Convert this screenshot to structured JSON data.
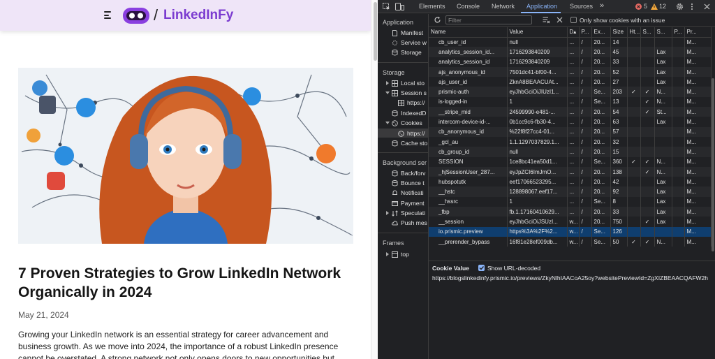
{
  "site": {
    "logo_slash": "/",
    "logo_text": "LinkedInFy"
  },
  "article": {
    "title": "7 Proven Strategies to Grow LinkedIn Network Organically in 2024",
    "date": "May 21, 2024",
    "body": "Growing your LinkedIn network is an essential strategy for career advancement and business growth. As we move into 2024, the importance of a robust LinkedIn presence cannot be overstated. A strong network not only opens doors to new opportunities but also"
  },
  "devtools": {
    "tabs": [
      "Elements",
      "Console",
      "Network",
      "Application",
      "Sources"
    ],
    "active_tab": "Application",
    "more": "»",
    "error_count": "5",
    "warning_count": "12",
    "filter_placeholder": "Filter",
    "only_issue_label": "Only show cookies with an issue",
    "sidebar": {
      "application_head": "Application",
      "application_items": [
        "Manifest",
        "Service w",
        "Storage"
      ],
      "storage_head": "Storage",
      "storage_items": [
        "Local sto",
        "Session s",
        "https://",
        "IndexedD",
        "Cookies",
        "https://",
        "Cache sto"
      ],
      "background_head": "Background ser",
      "background_items": [
        "Back/forv",
        "Bounce t",
        "Notificati",
        "Payment",
        "Speculati",
        "Push mes"
      ],
      "frames_head": "Frames",
      "frames_items": [
        "top"
      ]
    },
    "columns": [
      "Name",
      "Value",
      "D▴",
      "P...",
      "Ex...",
      "Size",
      "Ht...",
      "S...",
      "S...",
      "P...",
      "Pr..."
    ],
    "rows": [
      [
        "cb_user_id",
        "null",
        "...",
        "/",
        "20...",
        "14",
        "",
        "",
        "",
        "",
        "M..."
      ],
      [
        "analytics_session_id...",
        "1716293840209",
        "...",
        "/",
        "20...",
        "45",
        "",
        "",
        "Lax",
        "",
        "M..."
      ],
      [
        "analytics_session_id",
        "1716293840209",
        "...",
        "/",
        "20...",
        "33",
        "",
        "",
        "Lax",
        "",
        "M..."
      ],
      [
        "ajs_anonymous_id",
        "7501dc41-bf00-4...",
        "...",
        "/",
        "20...",
        "52",
        "",
        "",
        "Lax",
        "",
        "M..."
      ],
      [
        "ajs_user_id",
        "ZknA8BEAACUAt...",
        "...",
        "/",
        "20...",
        "27",
        "",
        "",
        "Lax",
        "",
        "M..."
      ],
      [
        "prismic-auth",
        "eyJhbGciOiJIUzI1...",
        "...",
        "/",
        "Se...",
        "203",
        "✓",
        "✓",
        "N...",
        "",
        "M..."
      ],
      [
        "is-logged-in",
        "1",
        "...",
        "/",
        "Se...",
        "13",
        "",
        "✓",
        "N...",
        "",
        "M..."
      ],
      [
        "__stripe_mid",
        "24599990-e481-...",
        "...",
        "/",
        "20...",
        "54",
        "",
        "✓",
        "St...",
        "",
        "M..."
      ],
      [
        "intercom-device-id-...",
        "0b1cc9c6-fb30-4...",
        "...",
        "/",
        "20...",
        "63",
        "",
        "",
        "Lax",
        "",
        "M..."
      ],
      [
        "cb_anonymous_id",
        "%22f8f27cc4-01...",
        "...",
        "/",
        "20...",
        "57",
        "",
        "",
        "",
        "",
        "M..."
      ],
      [
        "_gcl_au",
        "1.1.1297037829.1...",
        "...",
        "/",
        "20...",
        "32",
        "",
        "",
        "",
        "",
        "M..."
      ],
      [
        "cb_group_id",
        "null",
        "...",
        "/",
        "20...",
        "15",
        "",
        "",
        "",
        "",
        "M..."
      ],
      [
        "SESSION",
        "1ce8bc41ea50d1...",
        "...",
        "/",
        "Se...",
        "360",
        "✓",
        "✓",
        "N...",
        "",
        "M..."
      ],
      [
        "_hjSessionUser_287...",
        "eyJpZCI6ImJmO...",
        "...",
        "/",
        "20...",
        "138",
        "",
        "✓",
        "N...",
        "",
        "M..."
      ],
      [
        "hubspotutk",
        "eef17066523295...",
        "...",
        "/",
        "20...",
        "42",
        "",
        "",
        "Lax",
        "",
        "M..."
      ],
      [
        "__hstc",
        "128898067.eef17...",
        "...",
        "/",
        "20...",
        "92",
        "",
        "",
        "Lax",
        "",
        "M..."
      ],
      [
        "__hssrc",
        "1",
        "...",
        "/",
        "Se...",
        "8",
        "",
        "",
        "Lax",
        "",
        "M..."
      ],
      [
        "_fbp",
        "fb.1.17160410629...",
        "...",
        "/",
        "20...",
        "33",
        "",
        "",
        "Lax",
        "",
        "M..."
      ],
      [
        "__session",
        "eyJhbGciOiJSUzI...",
        "w...",
        "/",
        "20...",
        "750",
        "",
        "✓",
        "Lax",
        "",
        "M..."
      ],
      [
        "io.prismic.preview",
        "https%3A%2F%2...",
        "w...",
        "/",
        "Se...",
        "126",
        "",
        "",
        "",
        "",
        "M..."
      ],
      [
        "__prerender_bypass",
        "16f81e28ef009db...",
        "w...",
        "/",
        "Se...",
        "50",
        "✓",
        "✓",
        "N...",
        "",
        "M..."
      ]
    ],
    "selected_row": "io.prismic.preview",
    "cookie_value_title": "Cookie Value",
    "show_url_decoded_label": "Show URL-decoded",
    "cookie_value": "https://blogslinkedinfy.prismic.io/previews/ZkyNlhIAACoA25oy?websitePreviewId=ZgXIZBEAACQAFW2h"
  }
}
